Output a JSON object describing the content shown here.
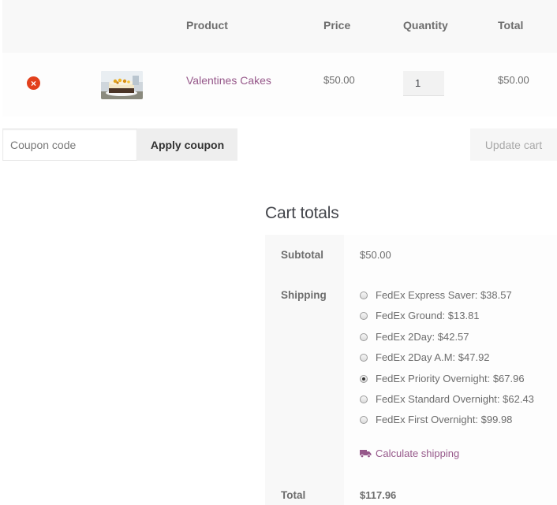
{
  "cart_table": {
    "headers": {
      "product": "Product",
      "price": "Price",
      "quantity": "Quantity",
      "total": "Total"
    },
    "rows": [
      {
        "remove_glyph": "×",
        "product_name": "Valentines Cakes",
        "price": "$50.00",
        "quantity": "1",
        "total": "$50.00",
        "remove_icon": "remove-x-circle-icon"
      }
    ]
  },
  "coupon": {
    "placeholder": "Coupon code",
    "apply_label": "Apply coupon",
    "update_label": "Update cart"
  },
  "cart_totals": {
    "title": "Cart totals",
    "subtotal_label": "Subtotal",
    "subtotal_value": "$50.00",
    "shipping_label": "Shipping",
    "shipping_options": [
      {
        "label": "FedEx Express Saver: $38.57",
        "selected": false
      },
      {
        "label": "FedEx Ground: $13.81",
        "selected": false
      },
      {
        "label": "FedEx 2Day: $42.57",
        "selected": false
      },
      {
        "label": "FedEx 2Day A.M: $47.92",
        "selected": false
      },
      {
        "label": "FedEx Priority Overnight: $67.96",
        "selected": true
      },
      {
        "label": "FedEx Standard Overnight: $62.43",
        "selected": false
      },
      {
        "label": "FedEx First Overnight: $99.98",
        "selected": false
      }
    ],
    "calculate_shipping_label": "Calculate shipping",
    "calculate_icon": "truck-icon",
    "total_label": "Total",
    "total_value": "$117.96"
  },
  "colors": {
    "link": "#96588a",
    "remove": "#e2401c",
    "text": "#43454b",
    "muted": "#6d6d6d"
  }
}
